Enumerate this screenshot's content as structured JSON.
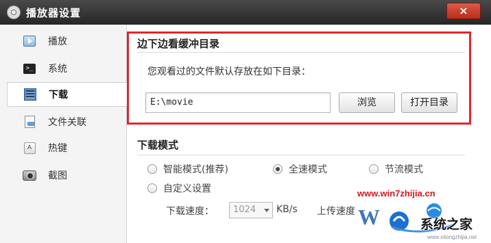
{
  "window": {
    "title": "播放器设置",
    "close_label": "×"
  },
  "sidebar": {
    "items": [
      {
        "label": "播放",
        "icon": "play-icon"
      },
      {
        "label": "系统",
        "icon": "terminal-icon"
      },
      {
        "label": "下载",
        "icon": "download-icon",
        "active": true
      },
      {
        "label": "文件关联",
        "icon": "file-association-icon"
      },
      {
        "label": "热键",
        "icon": "hotkey-icon"
      },
      {
        "label": "截图",
        "icon": "camera-icon"
      }
    ]
  },
  "cache": {
    "heading": "边下边看缓冲目录",
    "description": "您观看过的文件默认存放在如下目录：",
    "path_value": "E:\\movie",
    "browse_label": "浏览",
    "open_dir_label": "打开目录"
  },
  "download_mode": {
    "heading": "下载模式",
    "options": [
      {
        "label": "智能模式(推荐)",
        "checked": false
      },
      {
        "label": "全速模式",
        "checked": true
      },
      {
        "label": "节流模式",
        "checked": false
      },
      {
        "label": "自定义设置",
        "checked": false
      }
    ],
    "download_speed_label": "下载速度：",
    "download_speed_value": "1024",
    "download_speed_unit": "KB/s",
    "upload_speed_label": "上传速度"
  },
  "watermark": {
    "url": "www.win7zhijia.cn",
    "brand": "系统之家",
    "sub": "www.xitongzhijia.net"
  },
  "colors": {
    "highlight": "#e0262b",
    "titlebar": "#2e2e2e",
    "close_button": "#c9402c"
  }
}
